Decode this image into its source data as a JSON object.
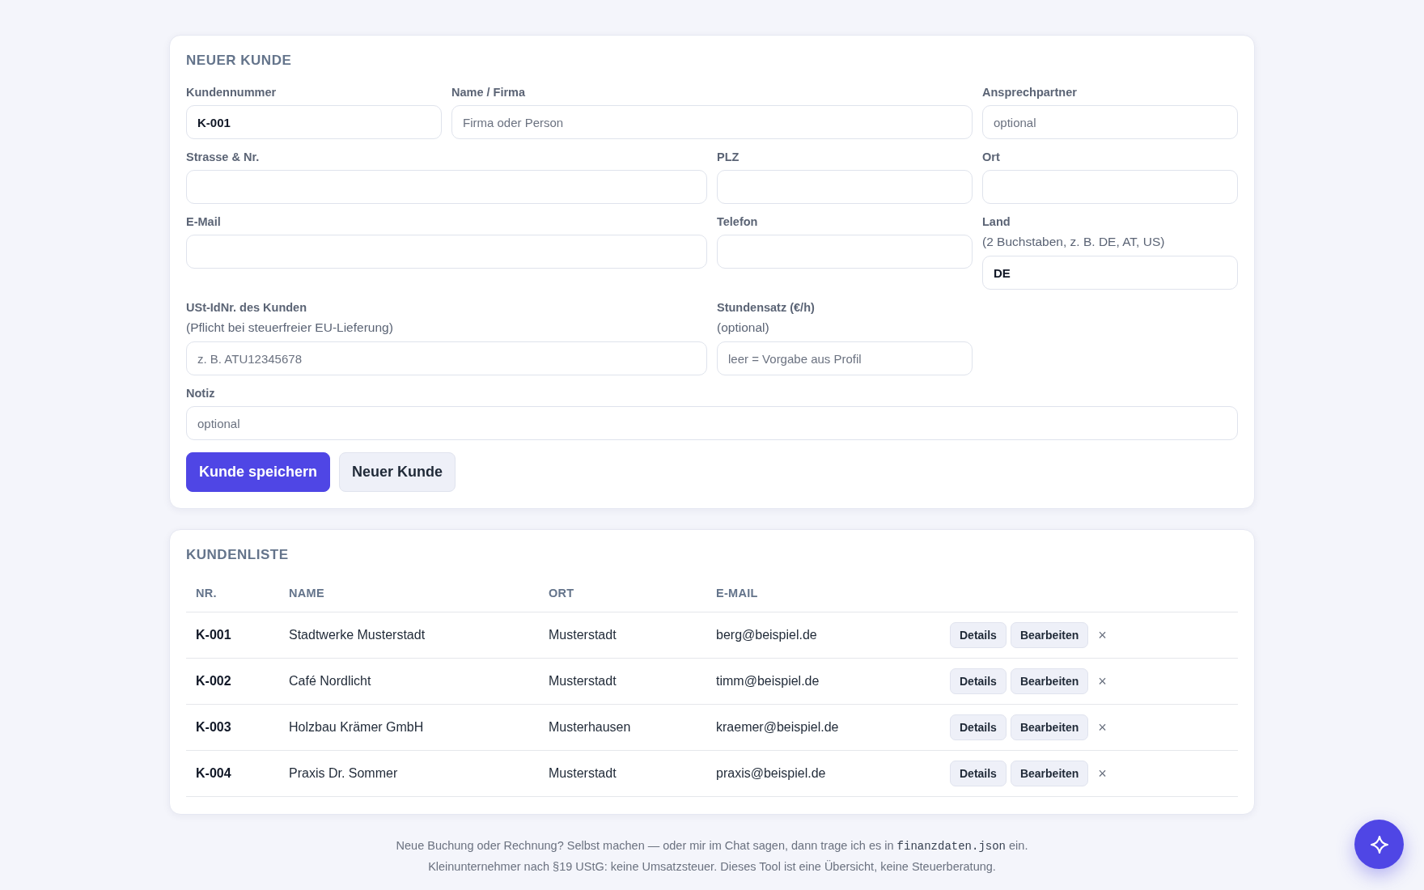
{
  "form": {
    "title": "NEUER KUNDE",
    "rows": [
      [
        {
          "label": "Kundennummer",
          "value": "K-001"
        },
        {
          "label": "Name / Firma",
          "placeholder": "Firma oder Person"
        },
        {
          "label": "Ansprechpartner",
          "placeholder": "optional"
        }
      ],
      [
        {
          "label": "Strasse & Nr."
        },
        {
          "label": "PLZ"
        },
        {
          "label": "Ort"
        }
      ],
      [
        {
          "label": "E-Mail"
        },
        {
          "label": "Telefon"
        },
        {
          "label": "Land",
          "sublabel": "(2 Buchstaben, z. B. DE, AT, US)",
          "value": "DE"
        }
      ],
      [
        {
          "label": "USt-IdNr. des Kunden",
          "sublabel": "(Pflicht bei steuerfreier EU-Lieferung)",
          "placeholder": "z. B. ATU12345678"
        },
        {
          "label": "Stundensatz (€/h)",
          "sublabel": "(optional)",
          "placeholder": "leer = Vorgabe aus Profil"
        }
      ],
      [
        {
          "label": "Notiz",
          "placeholder": "optional"
        }
      ]
    ],
    "buttons": [
      {
        "kind": "primary",
        "label": "Kunde speichern"
      },
      {
        "kind": "secondary",
        "label": "Neuer Kunde"
      }
    ]
  },
  "customer_list": {
    "title": "KUNDENLISTE",
    "columns": [
      "NR.",
      "NAME",
      "ORT",
      "E-MAIL"
    ],
    "rows": [
      {
        "nr": "K-001",
        "name": "Stadtwerke Musterstadt",
        "ort": "Musterstadt",
        "email": "berg@beispiel.de",
        "actions": [
          {
            "kind": "button",
            "label": "Details"
          },
          {
            "kind": "button",
            "label": "Bearbeiten"
          },
          {
            "kind": "delete",
            "label": "×"
          }
        ]
      },
      {
        "nr": "K-002",
        "name": "Café Nordlicht",
        "ort": "Musterstadt",
        "email": "timm@beispiel.de",
        "actions": [
          {
            "kind": "button",
            "label": "Details"
          },
          {
            "kind": "button",
            "label": "Bearbeiten"
          },
          {
            "kind": "delete",
            "label": "×"
          }
        ]
      },
      {
        "nr": "K-003",
        "name": "Holzbau Krämer GmbH",
        "ort": "Musterhausen",
        "email": "kraemer@beispiel.de",
        "actions": [
          {
            "kind": "button",
            "label": "Details"
          },
          {
            "kind": "button",
            "label": "Bearbeiten"
          },
          {
            "kind": "delete",
            "label": "×"
          }
        ]
      },
      {
        "nr": "K-004",
        "name": "Praxis Dr. Sommer",
        "ort": "Musterstadt",
        "email": "praxis@beispiel.de",
        "actions": [
          {
            "kind": "button",
            "label": "Details"
          },
          {
            "kind": "button",
            "label": "Bearbeiten"
          },
          {
            "kind": "delete",
            "label": "×"
          }
        ]
      }
    ]
  },
  "footer": {
    "lines": [
      [
        {
          "kind": "text",
          "text": "Neue Buchung oder Rechnung? Selbst machen — oder mir im Chat sagen, dann trage ich es in "
        },
        {
          "kind": "code",
          "text": "finanzdaten.json"
        },
        {
          "kind": "text",
          "text": " ein."
        }
      ],
      [
        {
          "kind": "text",
          "text": "Kleinunternehmer nach §19 UStG: keine Umsatzsteuer. Dieses Tool ist eine Übersicht, keine Steuerberatung."
        }
      ]
    ]
  }
}
